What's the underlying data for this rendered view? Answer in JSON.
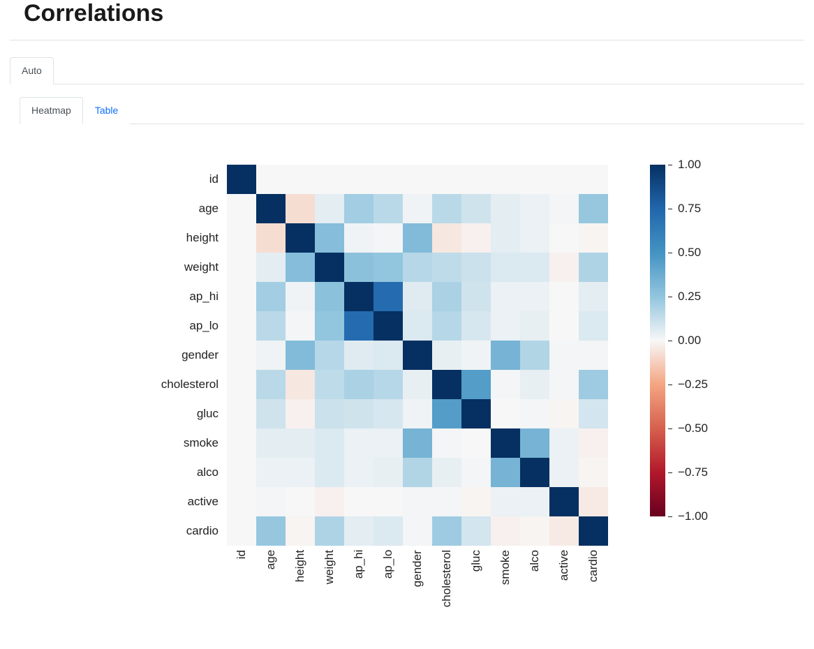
{
  "title": "Correlations",
  "tabs_main": [
    {
      "label": "Auto",
      "active": true
    }
  ],
  "tabs_sub": [
    {
      "label": "Heatmap",
      "active": true
    },
    {
      "label": "Table",
      "active": false
    }
  ],
  "chart_data": {
    "type": "heatmap",
    "title": "",
    "xlabel": "",
    "ylabel": "",
    "categories": [
      "id",
      "age",
      "height",
      "weight",
      "ap_hi",
      "ap_lo",
      "gender",
      "cholesterol",
      "gluc",
      "smoke",
      "alco",
      "active",
      "cardio"
    ],
    "matrix": [
      [
        1.0,
        0.0,
        0.0,
        0.0,
        0.0,
        0.0,
        0.0,
        0.0,
        0.0,
        0.0,
        0.0,
        0.0,
        0.0
      ],
      [
        0.0,
        1.0,
        -0.08,
        0.05,
        0.21,
        0.15,
        0.02,
        0.15,
        0.1,
        0.05,
        0.03,
        0.01,
        0.24
      ],
      [
        0.0,
        -0.08,
        1.0,
        0.29,
        0.02,
        0.01,
        0.3,
        -0.05,
        -0.02,
        0.05,
        0.03,
        0.0,
        -0.01
      ],
      [
        0.0,
        0.05,
        0.29,
        1.0,
        0.27,
        0.25,
        0.16,
        0.14,
        0.11,
        0.07,
        0.07,
        -0.02,
        0.18
      ],
      [
        0.0,
        0.21,
        0.02,
        0.27,
        1.0,
        0.72,
        0.06,
        0.19,
        0.1,
        0.03,
        0.03,
        0.0,
        0.05
      ],
      [
        0.0,
        0.15,
        0.01,
        0.25,
        0.72,
        1.0,
        0.07,
        0.16,
        0.08,
        0.03,
        0.04,
        0.0,
        0.07
      ],
      [
        0.0,
        0.02,
        0.3,
        0.16,
        0.06,
        0.07,
        1.0,
        0.04,
        0.02,
        0.34,
        0.17,
        0.01,
        0.01
      ],
      [
        0.0,
        0.15,
        -0.05,
        0.14,
        0.19,
        0.16,
        0.04,
        1.0,
        0.45,
        0.01,
        0.04,
        0.01,
        0.22
      ],
      [
        0.0,
        0.1,
        -0.02,
        0.11,
        0.1,
        0.08,
        0.02,
        0.45,
        1.0,
        0.0,
        0.01,
        -0.01,
        0.09
      ],
      [
        0.0,
        0.05,
        0.05,
        0.07,
        0.03,
        0.03,
        0.34,
        0.01,
        0.0,
        1.0,
        0.34,
        0.03,
        -0.02
      ],
      [
        0.0,
        0.03,
        0.03,
        0.07,
        0.03,
        0.04,
        0.17,
        0.04,
        0.01,
        0.34,
        1.0,
        0.03,
        -0.01
      ],
      [
        0.0,
        0.01,
        0.0,
        -0.02,
        0.0,
        0.0,
        0.01,
        0.01,
        -0.01,
        0.03,
        0.03,
        1.0,
        -0.04
      ],
      [
        0.0,
        0.24,
        -0.01,
        0.18,
        0.05,
        0.07,
        0.01,
        0.22,
        0.09,
        -0.02,
        -0.01,
        -0.04,
        1.0
      ]
    ],
    "colorbar": {
      "vmin": -1.0,
      "vmax": 1.0,
      "ticks": [
        1.0,
        0.75,
        0.5,
        0.25,
        0.0,
        -0.25,
        -0.5,
        -0.75,
        -1.0
      ],
      "tick_labels": [
        "1.00",
        "0.75",
        "0.50",
        "0.25",
        "0.00",
        "−0.25",
        "−0.50",
        "−0.75",
        "−1.00"
      ]
    }
  }
}
